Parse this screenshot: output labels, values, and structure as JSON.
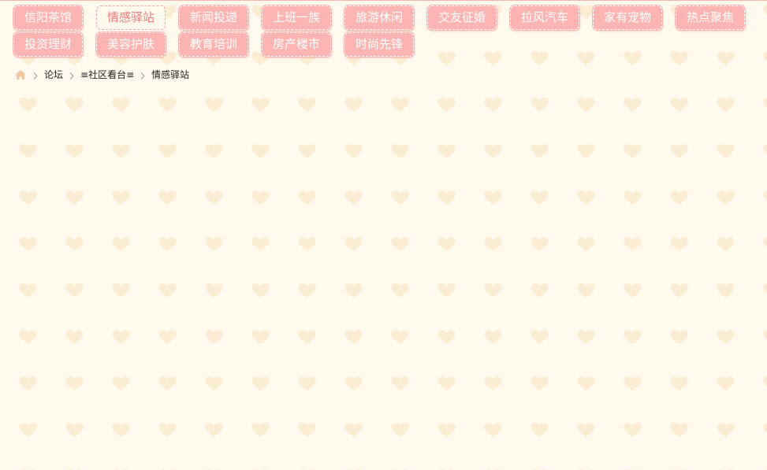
{
  "nav": {
    "row1": [
      {
        "label": "信阳茶馆",
        "active": false
      },
      {
        "label": "情感驿站",
        "active": true
      },
      {
        "label": "新闻投递",
        "active": false
      },
      {
        "label": "上班一族",
        "active": false
      },
      {
        "label": "旅游休闲",
        "active": false
      },
      {
        "label": "交友征婚",
        "active": false
      },
      {
        "label": "拉风汽车",
        "active": false
      },
      {
        "label": "家有宠物",
        "active": false
      },
      {
        "label": "热点聚焦",
        "active": false
      }
    ],
    "row2": [
      {
        "label": "投资理财",
        "active": false
      },
      {
        "label": "美容护肤",
        "active": false
      },
      {
        "label": "教育培训",
        "active": false
      },
      {
        "label": "房产楼市",
        "active": false
      },
      {
        "label": "时尚先锋",
        "active": false
      }
    ]
  },
  "breadcrumb": {
    "home_icon": "home-icon",
    "items": [
      "论坛",
      "≡社区看台≡",
      "情感驿站"
    ]
  },
  "colors": {
    "background": "#fff9ee",
    "button_fill": "#fdb5b3",
    "active_text": "#f07b7b",
    "heart_pattern": "#fbedd3"
  }
}
